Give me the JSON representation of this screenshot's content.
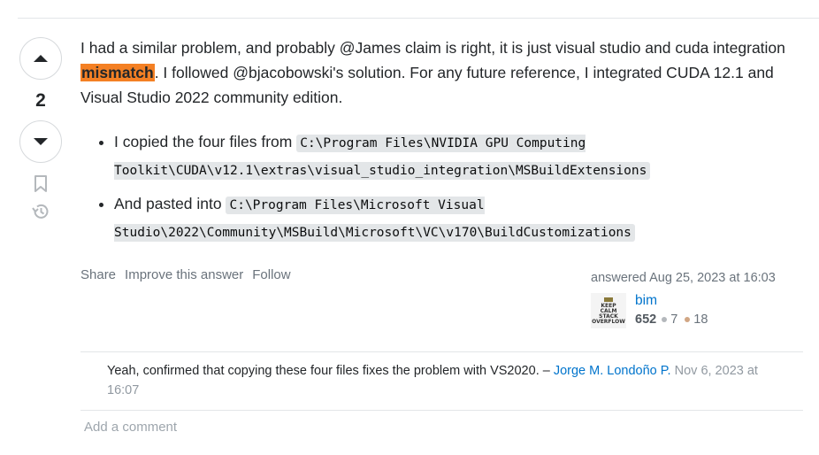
{
  "vote": {
    "count": "2",
    "up_icon": "caret-up-icon",
    "down_icon": "caret-down-icon",
    "bookmark_icon": "bookmark-icon",
    "history_icon": "history-icon"
  },
  "answer": {
    "intro_before": "I had a similar problem, and probably @James claim is right, it is just visual studio and cuda integration ",
    "highlight": "mismatch",
    "intro_after": ". I followed @bjacobowski's solution. For any future reference, I integrated CUDA 12.1 and Visual Studio 2022 community edition.",
    "steps": [
      {
        "text": "I copied the four files from ",
        "code": "C:\\Program Files\\NVIDIA GPU Computing Toolkit\\CUDA\\v12.1\\extras\\visual_studio_integration\\MSBuildExtensions"
      },
      {
        "text": "And pasted into ",
        "code": "C:\\Program Files\\Microsoft Visual Studio\\2022\\Community\\MSBuild\\Microsoft\\VC\\v170\\BuildCustomizations"
      }
    ]
  },
  "menu": {
    "share": "Share",
    "improve": "Improve this answer",
    "follow": "Follow"
  },
  "signature": {
    "action": "answered Aug 25, 2023 at 16:03",
    "user": "bim",
    "reputation": "652",
    "silver": "7",
    "bronze": "18",
    "avatar_lines": [
      "KEEP",
      "CALM",
      "STACK",
      "OVERFLOW"
    ]
  },
  "comments": [
    {
      "text": "Yeah, confirmed that copying these four files fixes the problem with VS2020. – ",
      "user": "Jorge M. Londoño P.",
      "date": "Nov 6, 2023 at 16:07"
    }
  ],
  "add_comment": "Add a comment"
}
